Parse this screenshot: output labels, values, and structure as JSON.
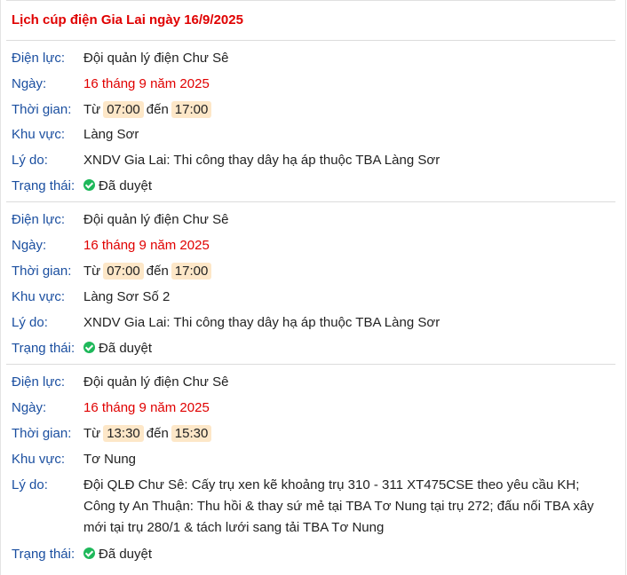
{
  "title": "Lịch cúp điện Gia Lai ngày 16/9/2025",
  "labels": {
    "dien_luc": "Điện lực:",
    "ngay": "Ngày:",
    "thoi_gian": "Thời gian:",
    "khu_vuc": "Khu vực:",
    "ly_do": "Lý do:",
    "trang_thai": "Trạng thái:",
    "tu": "Từ",
    "den": "đến"
  },
  "outages": [
    {
      "dien_luc": "Đội quản lý điện Chư Sê",
      "ngay": "16 tháng 9 năm 2025",
      "start": "07:00",
      "end": "17:00",
      "khu_vuc": "Làng Sơr",
      "ly_do": "XNDV Gia Lai: Thi công thay dây hạ áp thuộc TBA Làng Sơr",
      "trang_thai": "Đã duyệt"
    },
    {
      "dien_luc": "Đội quản lý điện Chư Sê",
      "ngay": "16 tháng 9 năm 2025",
      "start": "07:00",
      "end": "17:00",
      "khu_vuc": "Làng Sơr Số 2",
      "ly_do": "XNDV Gia Lai: Thi công thay dây hạ áp thuộc TBA Làng Sơr",
      "trang_thai": "Đã duyệt"
    },
    {
      "dien_luc": "Đội quản lý điện Chư Sê",
      "ngay": "16 tháng 9 năm 2025",
      "start": "13:30",
      "end": "15:30",
      "khu_vuc": "Tơ Nung",
      "ly_do": "Đội QLĐ Chư Sê: Cấy trụ xen kẽ khoảng trụ 310 - 311 XT475CSE theo yêu cầu KH; Công ty An Thuận: Thu hồi & thay sứ mẻ tại TBA Tơ Nung tại trụ 272; đấu nối TBA xây mới tại trụ 280/1 & tách lưới sang tải TBA Tơ Nung",
      "trang_thai": "Đã duyệt"
    }
  ]
}
